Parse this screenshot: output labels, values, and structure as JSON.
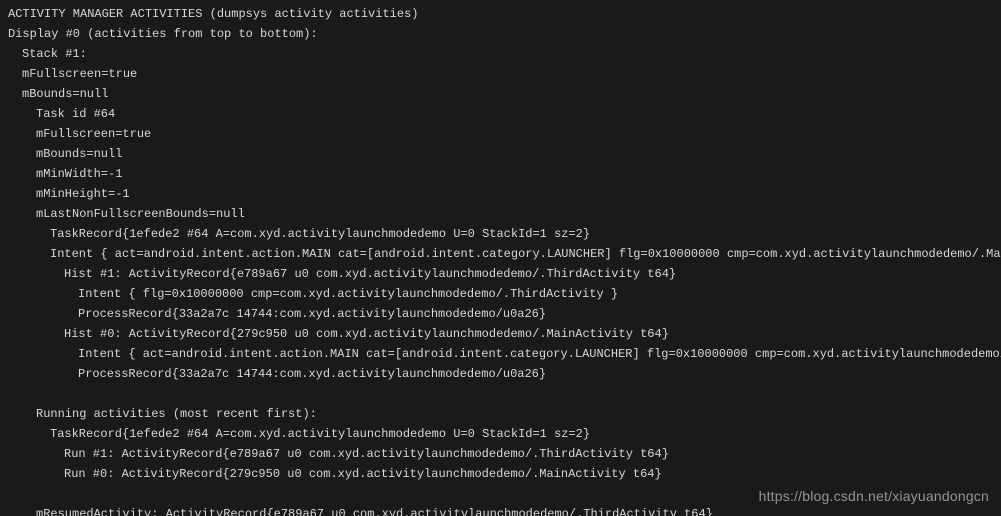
{
  "lines": [
    {
      "indent": 0,
      "text": "ACTIVITY MANAGER ACTIVITIES (dumpsys activity activities)"
    },
    {
      "indent": 0,
      "text": "Display #0 (activities from top to bottom):"
    },
    {
      "indent": 1,
      "text": "Stack #1:"
    },
    {
      "indent": 1,
      "text": "mFullscreen=true"
    },
    {
      "indent": 1,
      "text": "mBounds=null"
    },
    {
      "indent": 2,
      "text": "Task id #64"
    },
    {
      "indent": 2,
      "text": "mFullscreen=true"
    },
    {
      "indent": 2,
      "text": "mBounds=null"
    },
    {
      "indent": 2,
      "text": "mMinWidth=-1"
    },
    {
      "indent": 2,
      "text": "mMinHeight=-1"
    },
    {
      "indent": 2,
      "text": "mLastNonFullscreenBounds=null"
    },
    {
      "indent": 3,
      "text": "TaskRecord{1efede2 #64 A=com.xyd.activitylaunchmodedemo U=0 StackId=1 sz=2}"
    },
    {
      "indent": 3,
      "text": "Intent { act=android.intent.action.MAIN cat=[android.intent.category.LAUNCHER] flg=0x10000000 cmp=com.xyd.activitylaunchmodedemo/.MainActivity }"
    },
    {
      "indent": 4,
      "text": "Hist #1: ActivityRecord{e789a67 u0 com.xyd.activitylaunchmodedemo/.ThirdActivity t64}"
    },
    {
      "indent": 5,
      "text": "Intent { flg=0x10000000 cmp=com.xyd.activitylaunchmodedemo/.ThirdActivity }"
    },
    {
      "indent": 5,
      "text": "ProcessRecord{33a2a7c 14744:com.xyd.activitylaunchmodedemo/u0a26}"
    },
    {
      "indent": 4,
      "text": "Hist #0: ActivityRecord{279c950 u0 com.xyd.activitylaunchmodedemo/.MainActivity t64}"
    },
    {
      "indent": 5,
      "text": "Intent { act=android.intent.action.MAIN cat=[android.intent.category.LAUNCHER] flg=0x10000000 cmp=com.xyd.activitylaunchmodedemo/.MainActivity }"
    },
    {
      "indent": 5,
      "text": "ProcessRecord{33a2a7c 14744:com.xyd.activitylaunchmodedemo/u0a26}"
    },
    {
      "indent": 0,
      "text": ""
    },
    {
      "indent": 2,
      "text": "Running activities (most recent first):"
    },
    {
      "indent": 3,
      "text": "TaskRecord{1efede2 #64 A=com.xyd.activitylaunchmodedemo U=0 StackId=1 sz=2}"
    },
    {
      "indent": 4,
      "text": "Run #1: ActivityRecord{e789a67 u0 com.xyd.activitylaunchmodedemo/.ThirdActivity t64}"
    },
    {
      "indent": 4,
      "text": "Run #0: ActivityRecord{279c950 u0 com.xyd.activitylaunchmodedemo/.MainActivity t64}"
    },
    {
      "indent": 0,
      "text": ""
    },
    {
      "indent": 2,
      "text": "mResumedActivity: ActivityRecord{e789a67 u0 com.xyd.activitylaunchmodedemo/.ThirdActivity t64}"
    }
  ],
  "watermark": "https://blog.csdn.net/xiayuandongcn"
}
